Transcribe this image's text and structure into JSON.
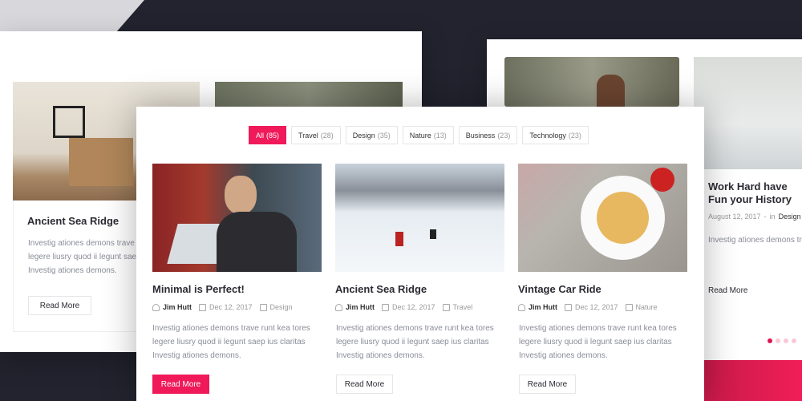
{
  "left_panel": {
    "nav": {
      "prev_icon": "‹",
      "next_icon": "›"
    },
    "card": {
      "title": "Ancient Sea Ridge",
      "excerpt": "Investig ationes demons trave runt kea tores legere liusry quod ii legunt saep ius claritas Investig ationes demons.",
      "button": "Read More"
    }
  },
  "right_panel": {
    "card": {
      "title": "Work Hard have Fun your History",
      "date": "August 12, 2017",
      "separator": "-",
      "in_label": "in",
      "category": "Design",
      "excerpt": "Investig ationes demons trave runt kea tores legere liusry quod ii legunt saep ius claritas Investig ationes demons.",
      "button": "Read More"
    },
    "pagination_dots": 4,
    "active_dot": 1
  },
  "main": {
    "filters": [
      {
        "label": "All",
        "count": "(85)",
        "active": true
      },
      {
        "label": "Travel",
        "count": "(28)"
      },
      {
        "label": "Design",
        "count": "(35)"
      },
      {
        "label": "Nature",
        "count": "(13)"
      },
      {
        "label": "Business",
        "count": "(23)"
      },
      {
        "label": "Technology",
        "count": "(23)"
      }
    ],
    "posts": [
      {
        "title": "Minimal is Perfect!",
        "author": "Jim Hutt",
        "date": "Dec 12, 2017",
        "category": "Design",
        "excerpt": "Investig ationes demons trave runt kea tores legere liusry quod ii legunt saep ius claritas Investig ationes demons.",
        "button": "Read More"
      },
      {
        "title": "Ancient Sea Ridge",
        "author": "Jim Hutt",
        "date": "Dec 12, 2017",
        "category": "Travel",
        "excerpt": "Investig ationes demons trave runt kea tores legere liusry quod ii legunt saep ius claritas Investig ationes demons.",
        "button": "Read More"
      },
      {
        "title": "Vintage Car Ride",
        "author": "Jim Hutt",
        "date": "Dec 12, 2017",
        "category": "Nature",
        "excerpt": "Investig ationes demons trave runt kea tores legere liusry quod ii legunt saep ius claritas Investig ationes demons.",
        "button": "Read More"
      }
    ]
  },
  "colors": {
    "accent": "#f0195a",
    "background": "#22232e"
  }
}
